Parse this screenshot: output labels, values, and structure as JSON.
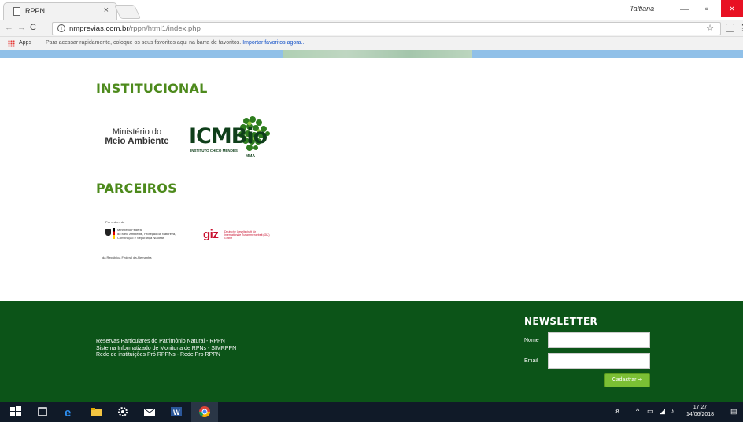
{
  "browser": {
    "tab_title": "RPPN",
    "tab_close": "×",
    "profile_name": "Taltiana",
    "url_host": "nmprevias.com.br",
    "url_path": "/rppn/html1/index.php",
    "bookmarks": {
      "apps_label": "Apps",
      "hint": "Para acessar rapidamente, coloque os seus favoritos aqui na barra de favoritos.",
      "import_link": "Importar favoritos agora..."
    }
  },
  "page": {
    "institucional_title": "INSTITUCIONAL",
    "mma_line1": "Ministério do",
    "mma_line2": "Meio Ambiente",
    "icmbio_text": "ICMBio",
    "icmbio_sub": "INSTITUTO CHICO MENDES",
    "icmbio_mma": "MMA",
    "parceiros_title": "PARCEIROS",
    "bmz_top": "Por ordem do",
    "bmz_lines": [
      "Ministério Federal",
      "do Meio Ambiente, Proteção da Natureza,",
      "Construção e Segurança Nuclear"
    ],
    "bmz_bottom": "da República Federal da Alemanha",
    "giz_logo": "giz",
    "giz_sub": "Deutsche Gesellschaft für Internationale Zusammenarbeit (GIZ) GmbH"
  },
  "footer": {
    "links": [
      "Reservas Particulares do Patrimônio Natural - RPPN",
      "Sistema Informatizado de Monitoria de RPNs - SIMRPPN",
      "Rede de instituições Pró RPPNs - Rede Pro RPPN"
    ],
    "newsletter_title": "NEWSLETTER",
    "name_label": "Nome",
    "email_label": "Email",
    "name_value": "",
    "email_value": "",
    "submit_label": "Cadastrar"
  },
  "taskbar": {
    "time": "17:27",
    "date": "14/06/2018"
  },
  "colors": {
    "brand_green": "#4d8a1c",
    "footer_green": "#0c5418",
    "button_green": "#7bbf34"
  }
}
